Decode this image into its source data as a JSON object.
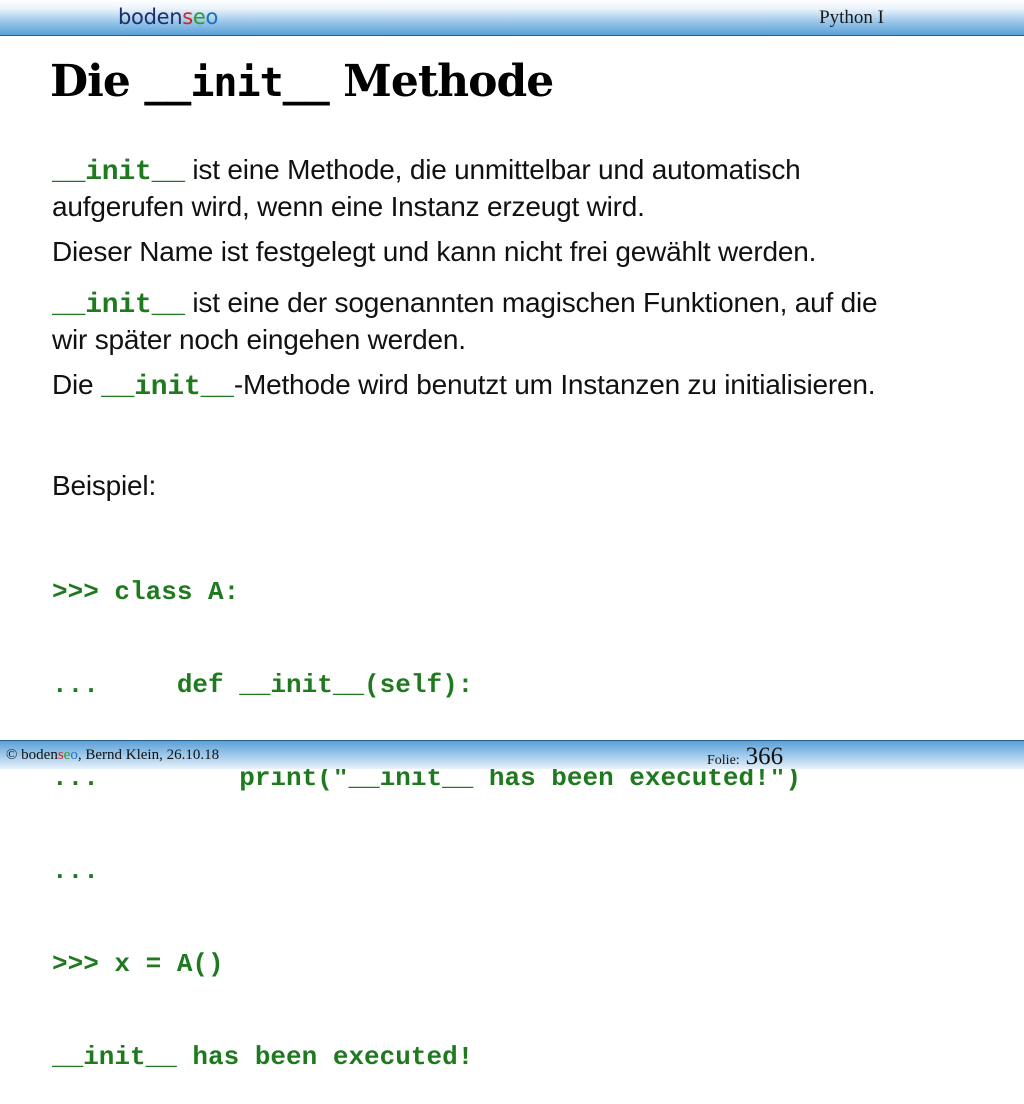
{
  "header": {
    "logo": {
      "part1": "boden",
      "s": "s",
      "e": "e",
      "o": "o"
    },
    "course": "Python I"
  },
  "slide": {
    "title": {
      "pre": "Die ",
      "code": "__init__",
      "post": " Methode"
    },
    "para1": {
      "code": "__init__",
      "line1": " ist eine Methode, die unmittelbar und automatisch",
      "line2": "aufgerufen wird, wenn eine Instanz erzeugt wird."
    },
    "para2": "Dieser Name ist festgelegt und kann nicht frei gewählt werden.",
    "para3": {
      "code": "__init__",
      "line1": "  ist eine der sogenannten magischen Funktionen, auf die",
      "line2": "wir später noch eingehen werden."
    },
    "para4": {
      "pre": "Die ",
      "code": "__init__",
      "post": "-Methode wird benutzt um Instanzen zu initialisieren."
    },
    "example_label": "Beispiel:",
    "code_lines": [
      ">>> class A:",
      "...     def __init__(self):",
      "...         print(\"__init__ has been executed!\")",
      "...",
      ">>> x = A()",
      "__init__ has been executed!"
    ]
  },
  "footer": {
    "copyright": "© ",
    "brand": {
      "part1": "boden",
      "s": "s",
      "e": "e",
      "o": "o"
    },
    "author": ", Bernd Klein, 26.10.18",
    "folie_label": "Folie:",
    "folie_number": "366"
  },
  "colors": {
    "code_green": "#1f7a1f",
    "bar_blue": "#5aa1d9",
    "logo_navy": "#1f2d6b"
  }
}
